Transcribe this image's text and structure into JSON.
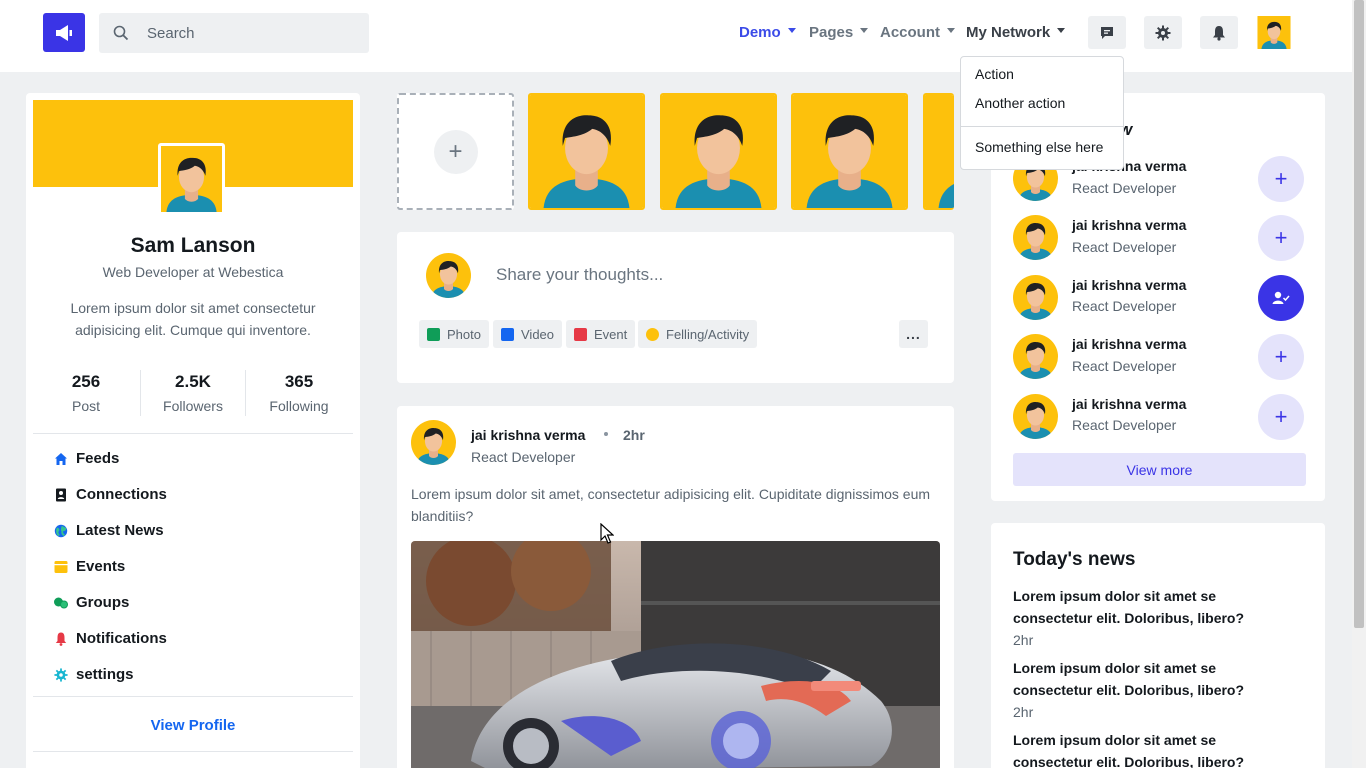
{
  "header": {
    "search_placeholder": "Search",
    "nav": [
      {
        "label": "Demo",
        "active": true
      },
      {
        "label": "Pages",
        "active": false
      },
      {
        "label": "Account",
        "active": false
      },
      {
        "label": "My Network",
        "active": false
      }
    ],
    "icons": [
      "chat-icon",
      "gear-icon",
      "bell-icon"
    ]
  },
  "dropdown": {
    "items": [
      "Action",
      "Another action",
      "Something else here"
    ]
  },
  "profile": {
    "name": "Sam Lanson",
    "role": "Web Developer at Webestica",
    "bio": "Lorem ipsum dolor sit amet consectetur adipisicing elit. Cumque qui inventore.",
    "stats": [
      {
        "value": "256",
        "label": "Post"
      },
      {
        "value": "2.5K",
        "label": "Followers"
      },
      {
        "value": "365",
        "label": "Following"
      }
    ],
    "menu": [
      {
        "label": "Feeds",
        "icon": "home-icon",
        "color": "#1466f0"
      },
      {
        "label": "Connections",
        "icon": "contact-book-icon",
        "color": "#14191e"
      },
      {
        "label": "Latest News",
        "icon": "globe-icon",
        "color": "#1466f0"
      },
      {
        "label": "Events",
        "icon": "calendar-icon",
        "color": "#fdc10c"
      },
      {
        "label": "Groups",
        "icon": "groups-icon",
        "color": "#0f9d58"
      },
      {
        "label": "Notifications",
        "icon": "bell-icon",
        "color": "#e63946"
      },
      {
        "label": "settings",
        "icon": "gear-icon",
        "color": "#17b6d1"
      }
    ],
    "view_profile": "View Profile"
  },
  "share": {
    "placeholder": "Share your thoughts...",
    "actions": [
      {
        "label": "Photo",
        "color": "#0f9d58"
      },
      {
        "label": "Video",
        "color": "#1466f0"
      },
      {
        "label": "Event",
        "color": "#e63946"
      },
      {
        "label": "Felling/Activity",
        "color": "#fdc10c"
      }
    ],
    "more": "..."
  },
  "post": {
    "author": "jai krishna verma",
    "time": "2hr",
    "role": "React Developer",
    "text": "Lorem ipsum dolor sit amet, consectetur adipisicing elit. Cupiditate dignissimos eum blanditiis?"
  },
  "follow": {
    "title_partial": "w",
    "people": [
      {
        "name": "jai krishna verma",
        "role": "React Developer",
        "following": false
      },
      {
        "name": "jai krishna verma",
        "role": "React Developer",
        "following": false
      },
      {
        "name": "jai krishna verma",
        "role": "React Developer",
        "following": true
      },
      {
        "name": "jai krishna verma",
        "role": "React Developer",
        "following": false
      },
      {
        "name": "jai krishna verma",
        "role": "React Developer",
        "following": false
      }
    ],
    "view_more": "View more"
  },
  "news": {
    "title": "Today's news",
    "items": [
      {
        "headline": "Lorem ipsum dolor sit amet se consectetur elit. Doloribus, libero?",
        "time": "2hr"
      },
      {
        "headline": "Lorem ipsum dolor sit amet se consectetur elit. Doloribus, libero?",
        "time": "2hr"
      },
      {
        "headline": "Lorem ipsum dolor sit amet se consectetur elit. Doloribus, libero?",
        "time": ""
      }
    ]
  },
  "colors": {
    "brand": "#3a34e6",
    "accent_yellow": "#fdc10c",
    "link_blue": "#1466f0"
  }
}
